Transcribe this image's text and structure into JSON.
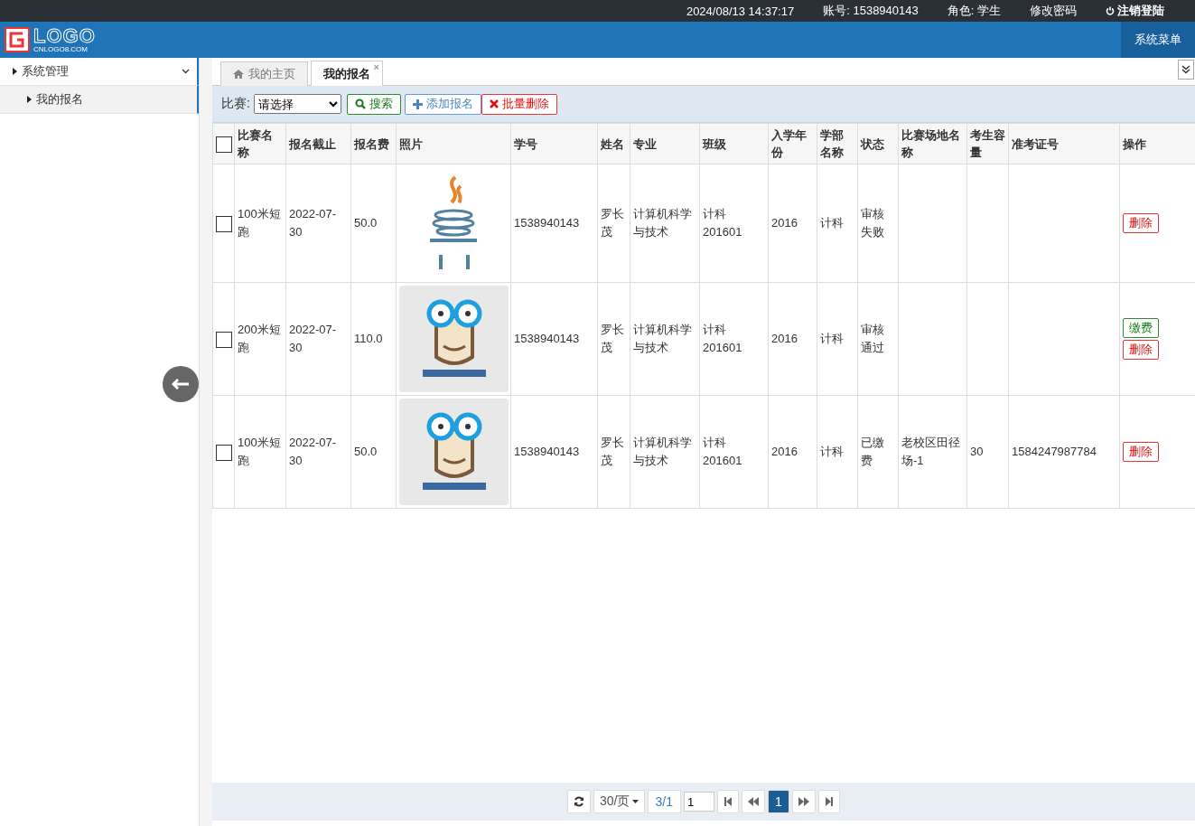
{
  "topbar": {
    "datetime": "2024/08/13 14:37:17",
    "account_label": "账号:",
    "account": "1538940143",
    "role_label": "角色:",
    "role": "学生",
    "change_password": "修改密码",
    "logout": "注销登陆"
  },
  "header": {
    "logo_text": "LOGO",
    "logo_sub": "CNLOGO8.COM",
    "menu_button": "系统菜单"
  },
  "sidebar": {
    "items": [
      {
        "label": "系统管理",
        "expanded": true,
        "children": [
          {
            "label": "我的报名",
            "selected": true
          }
        ]
      }
    ]
  },
  "tabs": [
    {
      "label": "我的主页",
      "selected": false
    },
    {
      "label": "我的报名",
      "selected": true,
      "close": "×"
    }
  ],
  "toolbar": {
    "filter_label": "比赛:",
    "filter_value": "请选择",
    "buttons": [
      {
        "label": "搜索",
        "kind": "search"
      },
      {
        "label": "添加报名",
        "kind": "add"
      },
      {
        "label": "批量删除",
        "kind": "delete"
      }
    ]
  },
  "table": {
    "select_all": {
      "checked": false
    },
    "columns": [
      "比赛名称",
      "报名截止",
      "报名费",
      "照片",
      "学号",
      "姓名",
      "专业",
      "班级",
      "入学年份",
      "学部名称",
      "状态",
      "比赛场地名称",
      "考生容量",
      "准考证号",
      "操作"
    ],
    "rows": [
      {
        "checked": false,
        "cells": [
          "100米短跑",
          "2022-07-30",
          "50.0",
          "",
          "1538940143",
          "罗长茂",
          "计算机科学与技术",
          "计科201601",
          "2016",
          "计科",
          "审核失败",
          "",
          "",
          "",
          ""
        ],
        "photo": {
          "kind": "cup"
        },
        "actions": [
          {
            "label": "删除",
            "kind": "delete"
          }
        ]
      },
      {
        "checked": false,
        "cells": [
          "200米短跑",
          "2022-07-30",
          "110.0",
          "",
          "1538940143",
          "罗长茂",
          "计算机科学与技术",
          "计科201601",
          "2016",
          "计科",
          "审核通过",
          "",
          "",
          "",
          ""
        ],
        "photo": {
          "kind": "monkey"
        },
        "actions": [
          {
            "label": "缴费",
            "kind": "pay"
          },
          {
            "label": "删除",
            "kind": "delete"
          }
        ]
      },
      {
        "checked": false,
        "cells": [
          "100米短跑",
          "2022-07-30",
          "50.0",
          "",
          "1538940143",
          "罗长茂",
          "计算机科学与技术",
          "计科201601",
          "2016",
          "计科",
          "已缴费",
          "老校区田径场-1",
          "30",
          "1584247987784",
          ""
        ],
        "photo": {
          "kind": "monkey"
        },
        "actions": [
          {
            "label": "删除",
            "kind": "delete"
          }
        ]
      }
    ]
  },
  "pagination": {
    "page_size": "30/页",
    "page_info": "3/1",
    "page_input": "1",
    "pages": [
      {
        "label": "1",
        "selected": true
      }
    ]
  }
}
